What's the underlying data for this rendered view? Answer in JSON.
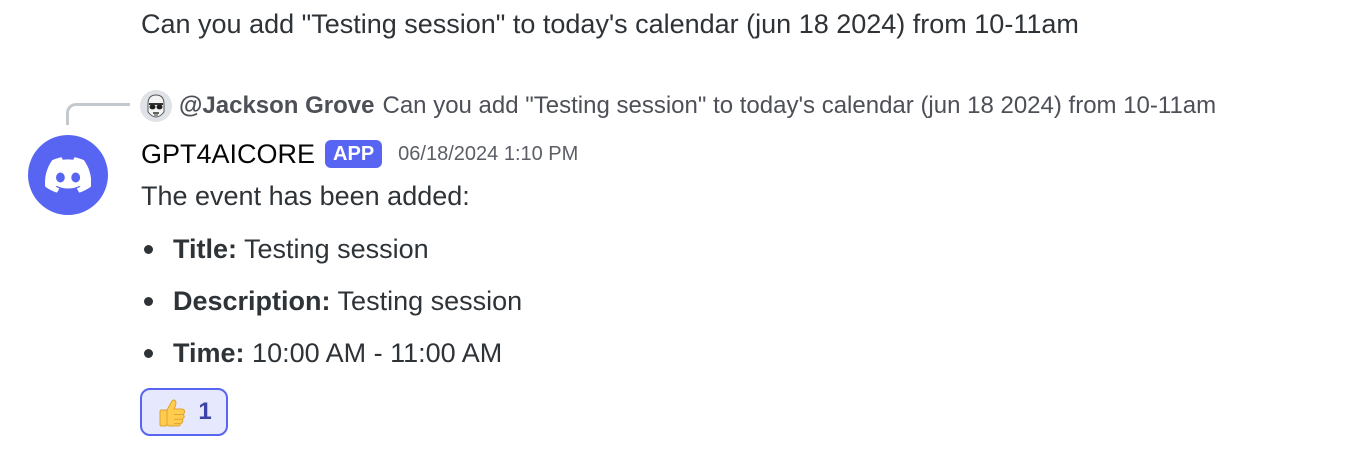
{
  "previous_message": {
    "text": "Can you add \"Testing session\" to today's calendar (jun 18 2024) from 10-11am"
  },
  "reply": {
    "author": "@Jackson Grove",
    "text": "Can you add \"Testing session\" to today's calendar (jun 18 2024) from 10-11am",
    "avatar_icon": "stormtrooper-avatar"
  },
  "message": {
    "author": "GPT4AICORE",
    "badge": "APP",
    "timestamp": "06/18/2024 1:10 PM",
    "avatar_icon": "discord-logo-icon",
    "intro": "The event has been added:",
    "items": [
      {
        "key": "Title:",
        "value": "Testing session"
      },
      {
        "key": "Description:",
        "value": "Testing session"
      },
      {
        "key": "Time:",
        "value": "10:00 AM - 11:00 AM"
      }
    ]
  },
  "reaction": {
    "emoji": "thumbs-up-icon",
    "count": "1"
  },
  "colors": {
    "accent": "#5865f2",
    "reaction_bg": "#e6e8fd",
    "text": "#2e3338",
    "muted": "#4e5058"
  }
}
